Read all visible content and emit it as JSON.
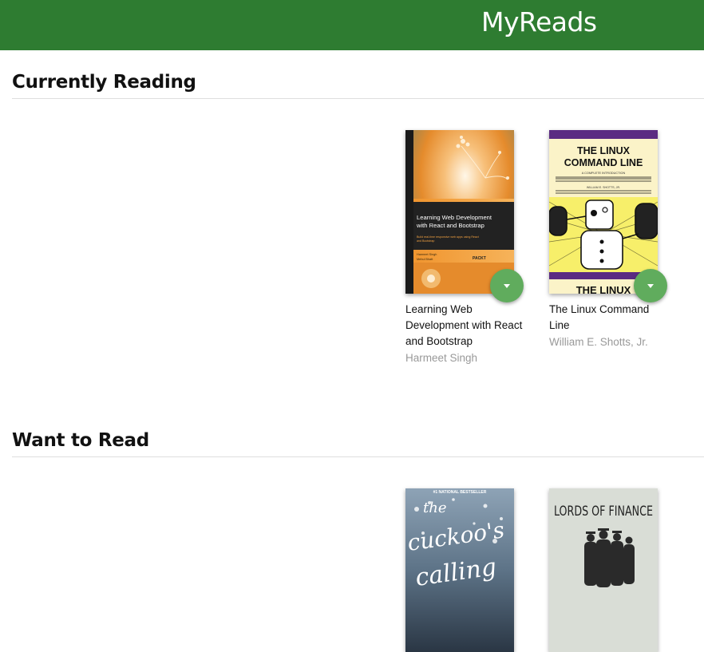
{
  "header": {
    "title": "MyReads"
  },
  "shelves": [
    {
      "title": "Currently Reading",
      "books": [
        {
          "title": "Learning Web Development with React and Bootstrap",
          "authors": "Harmeet Singh",
          "cover": {
            "title_line1": "Learning Web Development",
            "title_line2": "with React and Bootstrap",
            "subtitle_line1": "Build real-time responsive web apps using React",
            "subtitle_line2": "and Bootstrap",
            "authors_line1": "Harmeet Singh",
            "authors_line2": "Mehul Bhatt",
            "publisher": "PACKT"
          }
        },
        {
          "title": "The Linux Command Line",
          "authors": "William E. Shotts, Jr.",
          "cover": {
            "title_line1": "THE LINUX",
            "title_line2": "COMMAND LINE",
            "subtitle": "A COMPLETE INTRODUCTION",
            "author": "WILLIAM E. SHOTTS, JR.",
            "bottom_text": "THE LINUX"
          }
        }
      ]
    },
    {
      "title": "Want to Read",
      "books": [
        {
          "cover": {
            "banner": "#1 NATIONAL BESTSELLER",
            "title_line1": "the",
            "title_line2": "cuckoo's",
            "title_line3": "calling"
          }
        },
        {
          "cover": {
            "title": "LORDS OF FINANCE"
          }
        }
      ]
    }
  ],
  "colors": {
    "header": "#2e7c31",
    "shelf_changer": "#60ac5d",
    "author_text": "#999999"
  },
  "icons": {
    "shelf_changer": "triangle-down-icon"
  }
}
